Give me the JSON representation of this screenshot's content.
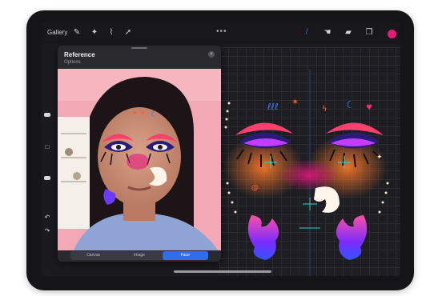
{
  "topbar": {
    "gallery_label": "Gallery",
    "left_tools": [
      "wrench-icon",
      "wand-icon",
      "selection-icon",
      "arrow-icon"
    ],
    "more": "•••",
    "right_tools": [
      "brush-icon",
      "smudge-icon",
      "eraser-icon",
      "layers-icon"
    ],
    "color": "#e5197c"
  },
  "reference": {
    "title": "Reference",
    "subtitle": "Options",
    "tabs": [
      "Canvas",
      "Image",
      "Face"
    ],
    "active_tab": "Face"
  },
  "colors": {
    "brush_active": "#3a6cf6",
    "tab_active": "#2f6cf2"
  }
}
